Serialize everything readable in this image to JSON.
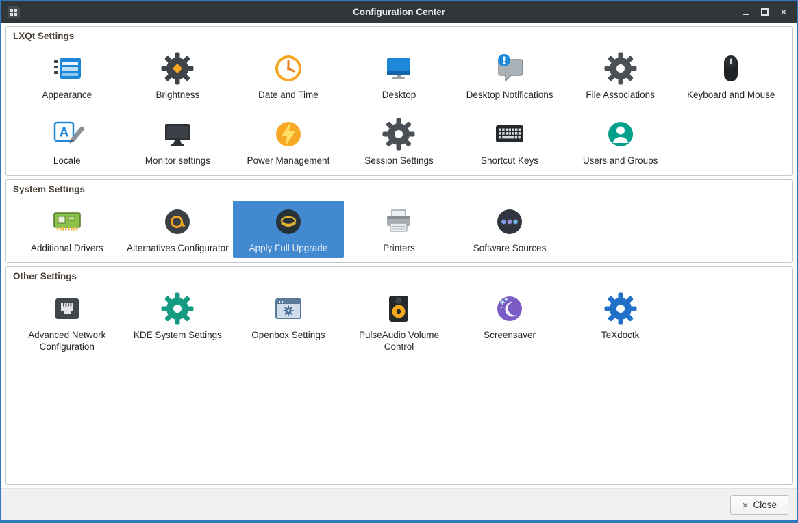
{
  "window": {
    "title": "Configuration Center",
    "app_icon": "configuration-center-app-icon",
    "controls": [
      {
        "name": "minimize-button",
        "icon": "minimize-icon"
      },
      {
        "name": "maximize-button",
        "icon": "maximize-icon"
      },
      {
        "name": "close-window-button",
        "icon": "close-icon"
      }
    ]
  },
  "sections": [
    {
      "title": "LXQt Settings",
      "items": [
        {
          "label": "Appearance",
          "icon": "appearance-icon"
        },
        {
          "label": "Brightness",
          "icon": "brightness-icon"
        },
        {
          "label": "Date and Time",
          "icon": "date-and-time-icon"
        },
        {
          "label": "Desktop",
          "icon": "desktop-icon"
        },
        {
          "label": "Desktop Notifications",
          "icon": "desktop-notifications-icon"
        },
        {
          "label": "File Associations",
          "icon": "file-associations-icon"
        },
        {
          "label": "Keyboard and Mouse",
          "icon": "keyboard-and-mouse-icon"
        },
        {
          "label": "Locale",
          "icon": "locale-icon"
        },
        {
          "label": "Monitor settings",
          "icon": "monitor-settings-icon"
        },
        {
          "label": "Power Management",
          "icon": "power-management-icon"
        },
        {
          "label": "Session Settings",
          "icon": "session-settings-icon"
        },
        {
          "label": "Shortcut Keys",
          "icon": "shortcut-keys-icon"
        },
        {
          "label": "Users and Groups",
          "icon": "users-and-groups-icon"
        }
      ]
    },
    {
      "title": "System Settings",
      "items": [
        {
          "label": "Additional Drivers",
          "icon": "additional-drivers-icon"
        },
        {
          "label": "Alternatives Configurator",
          "icon": "alternatives-configurator-icon"
        },
        {
          "label": "Apply Full Upgrade",
          "icon": "apply-full-upgrade-icon",
          "selected": true
        },
        {
          "label": "Printers",
          "icon": "printers-icon"
        },
        {
          "label": "Software Sources",
          "icon": "software-sources-icon"
        }
      ]
    },
    {
      "title": "Other Settings",
      "items": [
        {
          "label": "Advanced Network Configuration",
          "icon": "advanced-network-configuration-icon"
        },
        {
          "label": "KDE System Settings",
          "icon": "kde-system-settings-icon"
        },
        {
          "label": "Openbox Settings",
          "icon": "openbox-settings-icon"
        },
        {
          "label": "PulseAudio Volume Control",
          "icon": "pulseaudio-volume-control-icon"
        },
        {
          "label": "Screensaver",
          "icon": "screensaver-icon"
        },
        {
          "label": "TeXdoctk",
          "icon": "texdoctk-icon"
        }
      ]
    }
  ],
  "footer": {
    "close_label": "Close",
    "close_icon": "close-icon"
  },
  "colors": {
    "selection": "#4289cf",
    "titlebar": "#31363b",
    "window_border": "#3079bd"
  }
}
